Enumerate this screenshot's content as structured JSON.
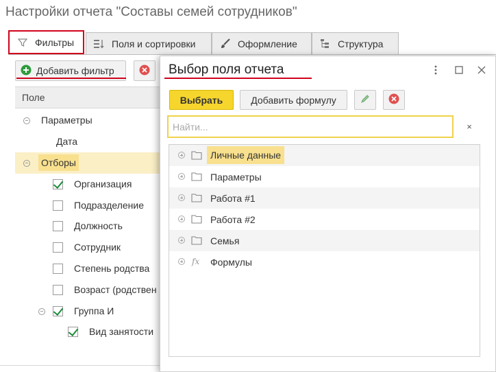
{
  "window": {
    "title": "Настройки отчета \"Составы семей сотрудников\""
  },
  "tabs": [
    {
      "label": "Фильтры",
      "icon": "filter-icon",
      "active": true
    },
    {
      "label": "Поля и сортировки",
      "icon": "fields-sort-icon"
    },
    {
      "label": "Оформление",
      "icon": "brush-icon"
    },
    {
      "label": "Структура",
      "icon": "structure-icon"
    }
  ],
  "toolbar": {
    "add_filter_label": "Добавить фильтр"
  },
  "filters_tree": {
    "column_header": "Поле",
    "rows": [
      {
        "label": "Параметры",
        "kind": "group-toggle"
      },
      {
        "label": "Дата",
        "kind": "item"
      },
      {
        "label": "Отборы",
        "kind": "group-toggle",
        "selected": true
      },
      {
        "label": "Организация",
        "checked": true
      },
      {
        "label": "Подразделение",
        "checked": false
      },
      {
        "label": "Должность",
        "checked": false
      },
      {
        "label": "Сотрудник",
        "checked": false
      },
      {
        "label": "Степень родства",
        "checked": false
      },
      {
        "label": "Возраст (родствен",
        "checked": false
      },
      {
        "label": "Группа И",
        "checked": true
      },
      {
        "label": "Вид занятости",
        "checked": true
      }
    ]
  },
  "dialog": {
    "title": "Выбор поля отчета",
    "choose_label": "Выбрать",
    "add_formula_label": "Добавить формулу",
    "search_placeholder": "Найти...",
    "search_clear": "×",
    "items": [
      {
        "label": "Личные данные",
        "icon": "folder-icon",
        "highlighted": true
      },
      {
        "label": "Параметры",
        "icon": "folder-icon"
      },
      {
        "label": "Работа #1",
        "icon": "folder-icon"
      },
      {
        "label": "Работа #2",
        "icon": "folder-icon"
      },
      {
        "label": "Семья",
        "icon": "folder-icon"
      },
      {
        "label": "Формулы",
        "icon": "fx-icon"
      }
    ]
  },
  "colors": {
    "accent_yellow": "#f6d62d",
    "highlight": "#f8e08f",
    "selected_row": "#fbefc6",
    "annotation_red": "#d0021b",
    "check_green": "#1a8a3a",
    "add_green": "#2e9b3e",
    "delete_red": "#e05050"
  }
}
